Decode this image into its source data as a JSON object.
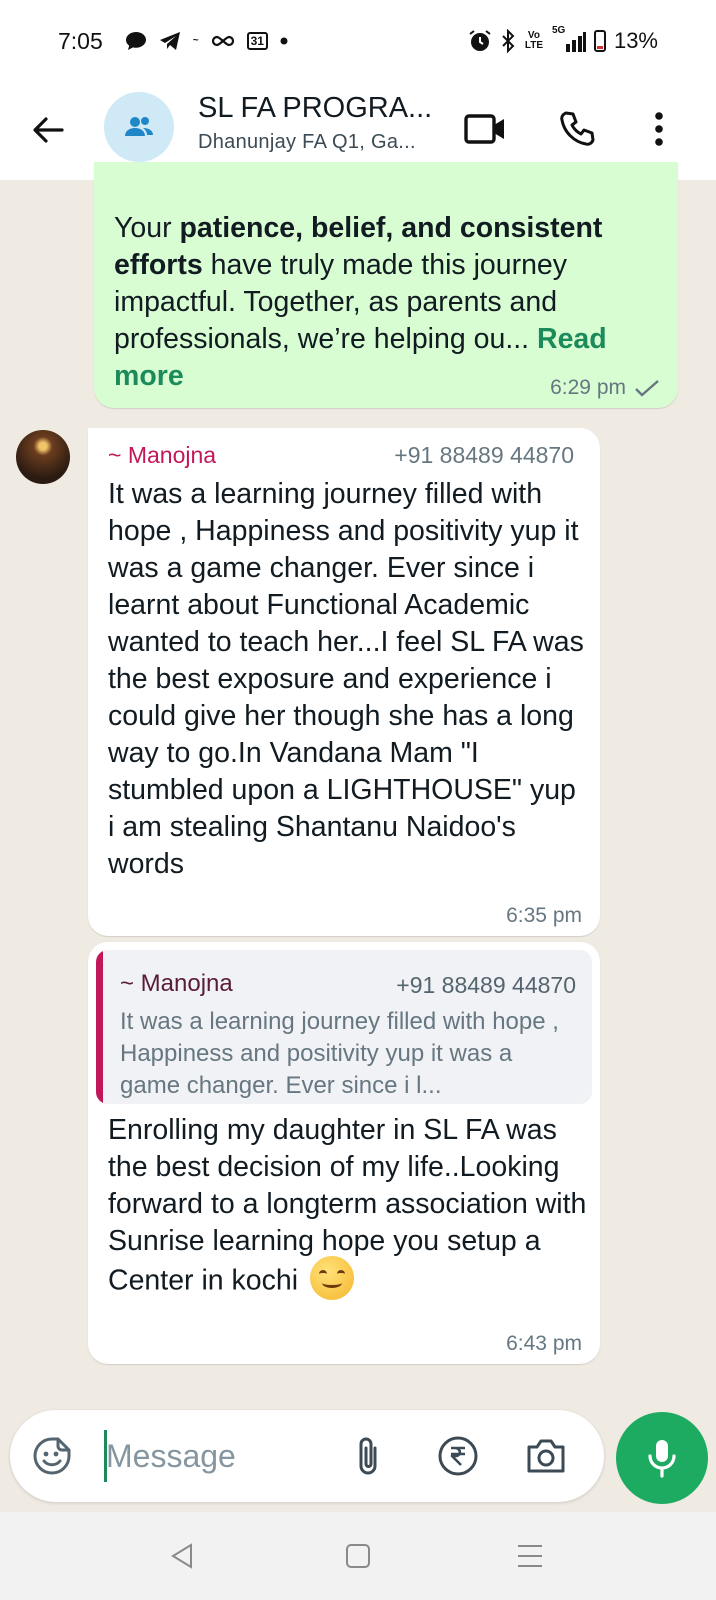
{
  "status_bar": {
    "time": "7:05",
    "calendar_day": "31",
    "network": "5G",
    "volte": "Vo LTE",
    "battery": "13%"
  },
  "header": {
    "title": "SL FA PROGRA...",
    "subtitle": "Dhanunjay FA Q1, Ga..."
  },
  "messages": {
    "outgoing": {
      "text_pre": "Your ",
      "text_bold_1": "patience, belief, and consistent efforts",
      "text_mid": " have truly made this journey impactful. Together, as parents and professionals, we’re helping ou... ",
      "read_more": "Read more",
      "time": "6:29 pm"
    },
    "incoming_1": {
      "sender": "~ Manojna",
      "phone": "+91 88489 44870",
      "text": "It was a learning journey filled with hope , Happiness and positivity yup it was a game changer. Ever since i learnt about Functional Academic wanted to teach her...I feel SL FA was the best exposure and experience i could give her though she has a long way to go.In Vandana Mam \"I stumbled upon a LIGHTHOUSE\" yup i am stealing Shantanu Naidoo's words",
      "time": "6:35 pm"
    },
    "incoming_2": {
      "quote_sender": "~ Manojna",
      "quote_phone": "+91 88489 44870",
      "quote_text": "It was a learning journey filled with hope , Happiness and positivity yup it was a game changer. Ever since i l...",
      "text": "Enrolling my daughter in SL FA was the best decision of my life..Looking forward to a longterm association with Sunrise learning hope you setup a Center in kochi",
      "time": "6:43 pm"
    }
  },
  "composer": {
    "placeholder": "Message"
  },
  "colors": {
    "accent_green": "#1daa61",
    "outgoing_bubble": "#d9fdd3",
    "sender_name": "#c2185b",
    "chat_bg": "#efeae2"
  },
  "icons": [
    "back-arrow-icon",
    "group-icon",
    "video-call-icon",
    "phone-icon",
    "more-vert-icon",
    "sticker-icon",
    "attach-icon",
    "rupee-icon",
    "camera-icon",
    "mic-icon",
    "double-check-icon"
  ]
}
